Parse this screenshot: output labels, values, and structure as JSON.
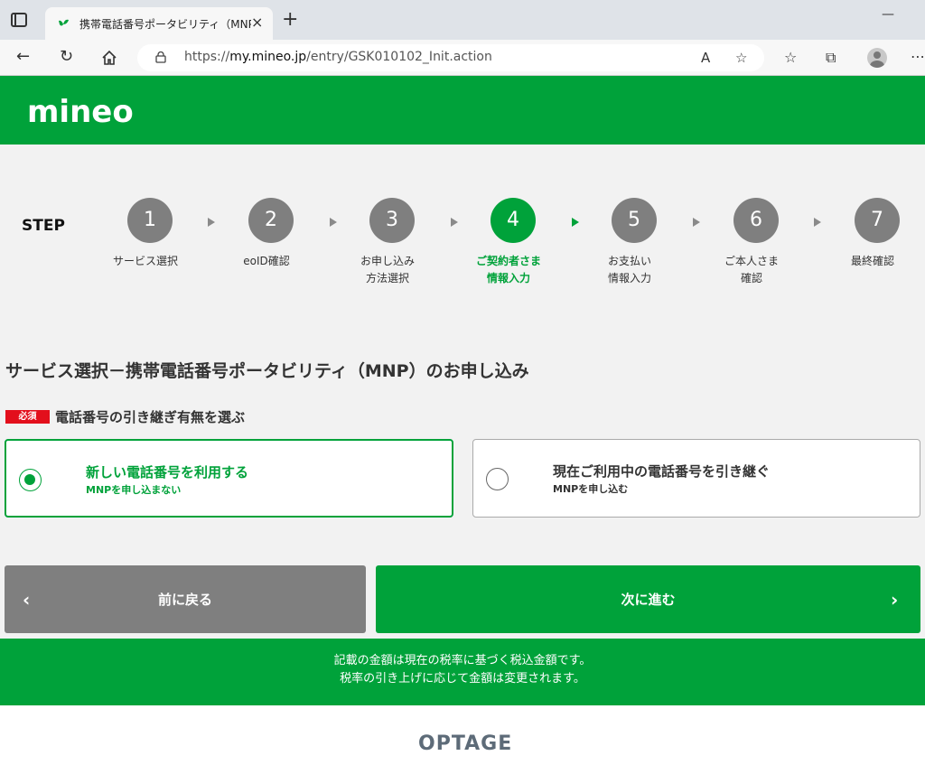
{
  "browser": {
    "tab_title": "携帯電話番号ポータビリティ（MNP）",
    "tab_close": "×",
    "new_tab": "+",
    "url_prefix": "https://",
    "url_host": "my.mineo.jp",
    "url_path": "/entry/GSK010102_Init.action"
  },
  "site": {
    "logo": "mineo"
  },
  "steps": {
    "label": "STEP",
    "items": [
      {
        "number": "1",
        "text_line1": "サービス選択",
        "text_line2": ""
      },
      {
        "number": "2",
        "text_line1": "eoID確認",
        "text_line2": ""
      },
      {
        "number": "3",
        "text_line1": "お申し込み",
        "text_line2": "方法選択"
      },
      {
        "number": "4",
        "text_line1": "ご契約者さま",
        "text_line2": "情報入力"
      },
      {
        "number": "5",
        "text_line1": "お支払い",
        "text_line2": "情報入力"
      },
      {
        "number": "6",
        "text_line1": "ご本人さま",
        "text_line2": "確認"
      },
      {
        "number": "7",
        "text_line1": "最終確認",
        "text_line2": ""
      }
    ],
    "active_step": "4"
  },
  "main": {
    "title": "サービス選択－携帯電話番号ポータビリティ（MNP）のお申し込み",
    "required_badge": "必須",
    "section_label": "電話番号の引き継ぎ有無を選ぶ",
    "options": [
      {
        "title": "新しい電話番号を利用する",
        "sub": "MNPを申し込まない",
        "selected": true
      },
      {
        "title": "現在ご利用中の電話番号を引き継ぐ",
        "sub": "MNPを申し込む",
        "selected": false
      }
    ],
    "back_label": "前に戻る",
    "next_label": "次に進む"
  },
  "tax_note": {
    "line1": "記載の金額は現在の税率に基づく税込金額です。",
    "line2": "税率の引き上げに応じて金額は変更されます。"
  },
  "footer": {
    "brand": "OPTAGE"
  },
  "colors": {
    "brand_green": "#00a23a",
    "inactive_gray": "#7f7f7f",
    "required_red": "#e30f1c"
  }
}
